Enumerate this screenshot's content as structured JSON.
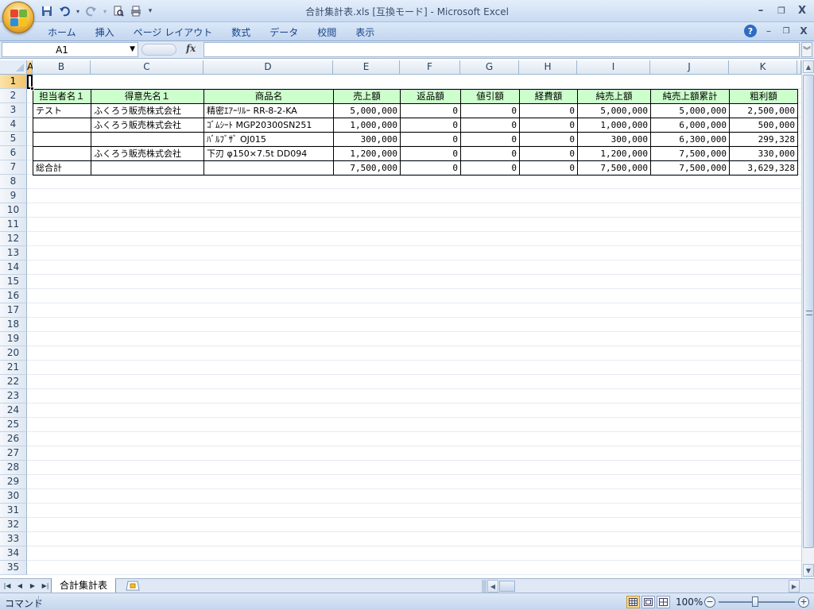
{
  "window": {
    "title": "合計集計表.xls  [互換モード] - Microsoft Excel",
    "minimize": "–",
    "restore": "❐",
    "close": "X"
  },
  "ribbon": {
    "tabs": [
      "ホーム",
      "挿入",
      "ページ レイアウト",
      "数式",
      "データ",
      "校閲",
      "表示"
    ],
    "help": "?",
    "minimize": "–",
    "restore": "❐",
    "close": "X"
  },
  "formula_bar": {
    "name_box": "A1",
    "fx_label": "fx",
    "formula": ""
  },
  "grid": {
    "columns": [
      "A",
      "B",
      "C",
      "D",
      "E",
      "F",
      "G",
      "H",
      "I",
      "J",
      "K"
    ],
    "selected_column": "A",
    "selected_row": 1,
    "rows": [
      "1",
      "2",
      "3",
      "4",
      "5",
      "6",
      "7",
      "8",
      "9",
      "10",
      "11",
      "12",
      "13",
      "14",
      "15",
      "16",
      "17",
      "18",
      "19",
      "20",
      "21",
      "22",
      "23",
      "24",
      "25",
      "26",
      "27",
      "28",
      "29",
      "30",
      "31",
      "32",
      "33",
      "34",
      "35"
    ],
    "header_row": [
      "担当者名１",
      "得意先名１",
      "商品名",
      "売上額",
      "返品額",
      "値引額",
      "経費額",
      "純売上額",
      "純売上額累計",
      "粗利額"
    ],
    "data_rows": [
      [
        "テスト",
        "ふくろう販売株式会社",
        "精密ｴｱｰﾘﾙｰ RR-8-2-KA",
        "5,000,000",
        "0",
        "0",
        "0",
        "5,000,000",
        "5,000,000",
        "2,500,000"
      ],
      [
        "",
        "ふくろう販売株式会社",
        "ｺﾞﾑｼｰﾄ MGP20300SN251",
        "1,000,000",
        "0",
        "0",
        "0",
        "1,000,000",
        "6,000,000",
        "500,000"
      ],
      [
        "",
        "",
        "ﾊﾞﾙﾌﾞｻﾞ OJ015",
        "300,000",
        "0",
        "0",
        "0",
        "300,000",
        "6,300,000",
        "299,328"
      ],
      [
        "",
        "ふくろう販売株式会社",
        "下刃 φ150×7.5t  DD094",
        "1,200,000",
        "0",
        "0",
        "0",
        "1,200,000",
        "7,500,000",
        "330,000"
      ],
      [
        "総合計",
        "",
        "",
        "7,500,000",
        "0",
        "0",
        "0",
        "7,500,000",
        "7,500,000",
        "3,629,328"
      ]
    ]
  },
  "sheets": {
    "active": "合計集計表"
  },
  "status": {
    "mode": "コマンド",
    "zoom": "100%",
    "zoom_minus": "−",
    "zoom_plus": "+"
  },
  "colors": {
    "header_fill": "#ccffcc",
    "selection_header": "#f3c46a",
    "ribbon": "#c3d6ef"
  }
}
